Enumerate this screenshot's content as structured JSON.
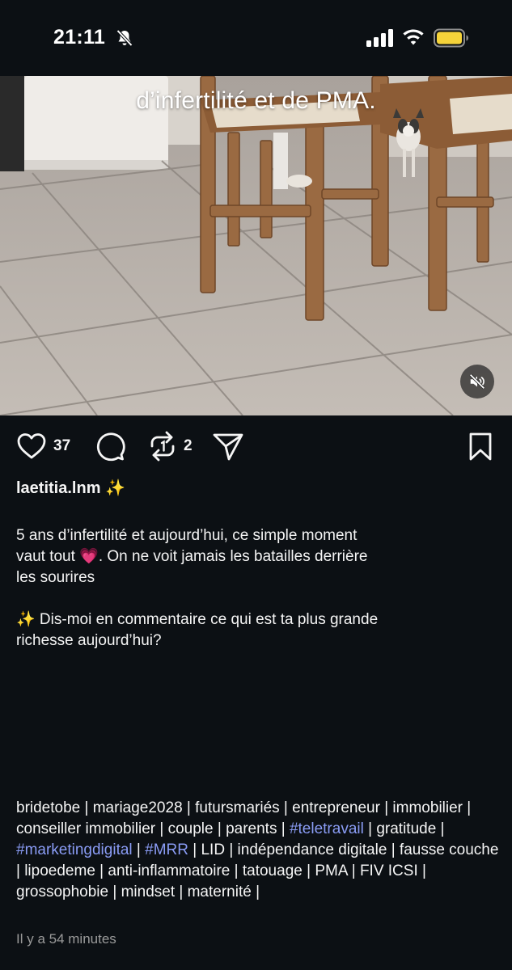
{
  "status_bar": {
    "time": "21:11",
    "silent_icon": "bell-slash-icon",
    "signal_icon": "cellular-signal-icon",
    "wifi_icon": "wifi-icon",
    "battery_icon": "battery-icon",
    "battery_color": "#f5d33a"
  },
  "video": {
    "overlay_text": "d’infertilité et de PMA.",
    "mute_icon": "speaker-muted-icon"
  },
  "actions": {
    "like_icon": "heart-icon",
    "like_count": "37",
    "comment_icon": "comment-icon",
    "repost_icon": "repost-icon",
    "repost_count": "2",
    "share_icon": "send-icon",
    "save_icon": "bookmark-icon"
  },
  "post": {
    "username": "laetitia.lnm ✨",
    "caption_1": "5 ans d’infertilité et aujourd’hui, ce simple moment\nvaut tout 💗. On ne voit jamais les batailles derrière\nles sourires",
    "caption_2": "✨ Dis-moi en commentaire ce qui est ta plus grande\nrichesse aujourd’hui?",
    "tags_before_1": "bridetobe | mariage2028 | futursmariés | entrepreneur | immobilier | conseiller immobilier | couple | parents | ",
    "hashtag_1": "#teletravail",
    "tags_between_1": " | gratitude | ",
    "hashtag_2": "#marketingdigital",
    "tags_between_2": " | ",
    "hashtag_3": "#MRR",
    "tags_after": " | LID | indépendance digitale | fausse couche | lipoedeme | anti-inflammatoire | tatouage | PMA | FIV ICSI | grossophobie | mindset | maternité |",
    "hashtag_color": "#8a9cf5",
    "time_ago": "Il y a 54 minutes"
  }
}
